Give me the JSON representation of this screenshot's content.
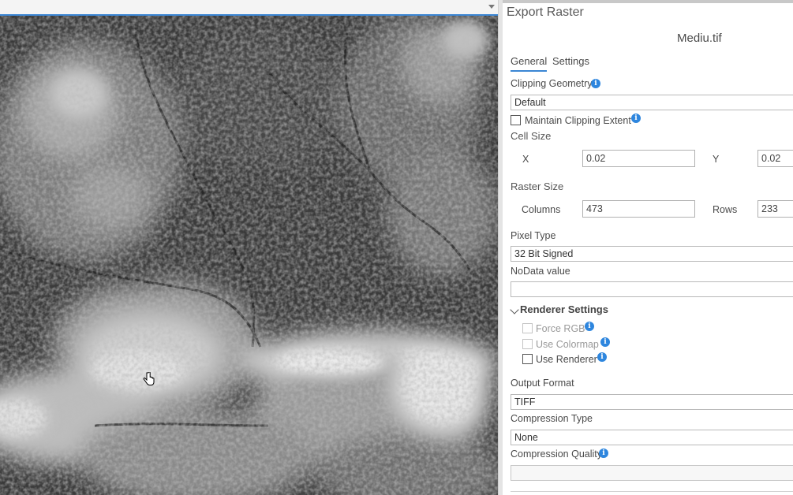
{
  "pane": {
    "title": "Export Raster",
    "filename": "Mediu.tif",
    "tabs": [
      {
        "label": "General",
        "active": true
      },
      {
        "label": "Settings",
        "active": false
      }
    ],
    "clipping_geometry": {
      "label": "Clipping Geometry",
      "value": "Default"
    },
    "maintain_clipping_extent": {
      "label": "Maintain Clipping Extent",
      "checked": false
    },
    "cell_size": {
      "label": "Cell Size",
      "x_label": "X",
      "x_value": "0.02",
      "y_label": "Y",
      "y_value": "0.02"
    },
    "raster_size": {
      "label": "Raster Size",
      "columns_label": "Columns",
      "columns_value": "473",
      "rows_label": "Rows",
      "rows_value": "233"
    },
    "pixel_type": {
      "label": "Pixel Type",
      "value": "32 Bit Signed"
    },
    "nodata": {
      "label": "NoData value",
      "value": ""
    },
    "renderer_settings": {
      "label": "Renderer Settings",
      "force_rgb": {
        "label": "Force RGB",
        "checked": false,
        "enabled": false
      },
      "use_colormap": {
        "label": "Use Colormap",
        "checked": false,
        "enabled": false
      },
      "use_renderer": {
        "label": "Use Renderer",
        "checked": false,
        "enabled": true
      }
    },
    "output_format": {
      "label": "Output Format",
      "value": "TIFF"
    },
    "compression_type": {
      "label": "Compression Type",
      "value": "None"
    },
    "compression_quality": {
      "label": "Compression Quality",
      "value": ""
    }
  },
  "icons": {
    "info": "info-icon",
    "cursor": "hand-cursor-icon"
  },
  "colors": {
    "accent": "#3b86d4",
    "info": "#2e86de"
  }
}
